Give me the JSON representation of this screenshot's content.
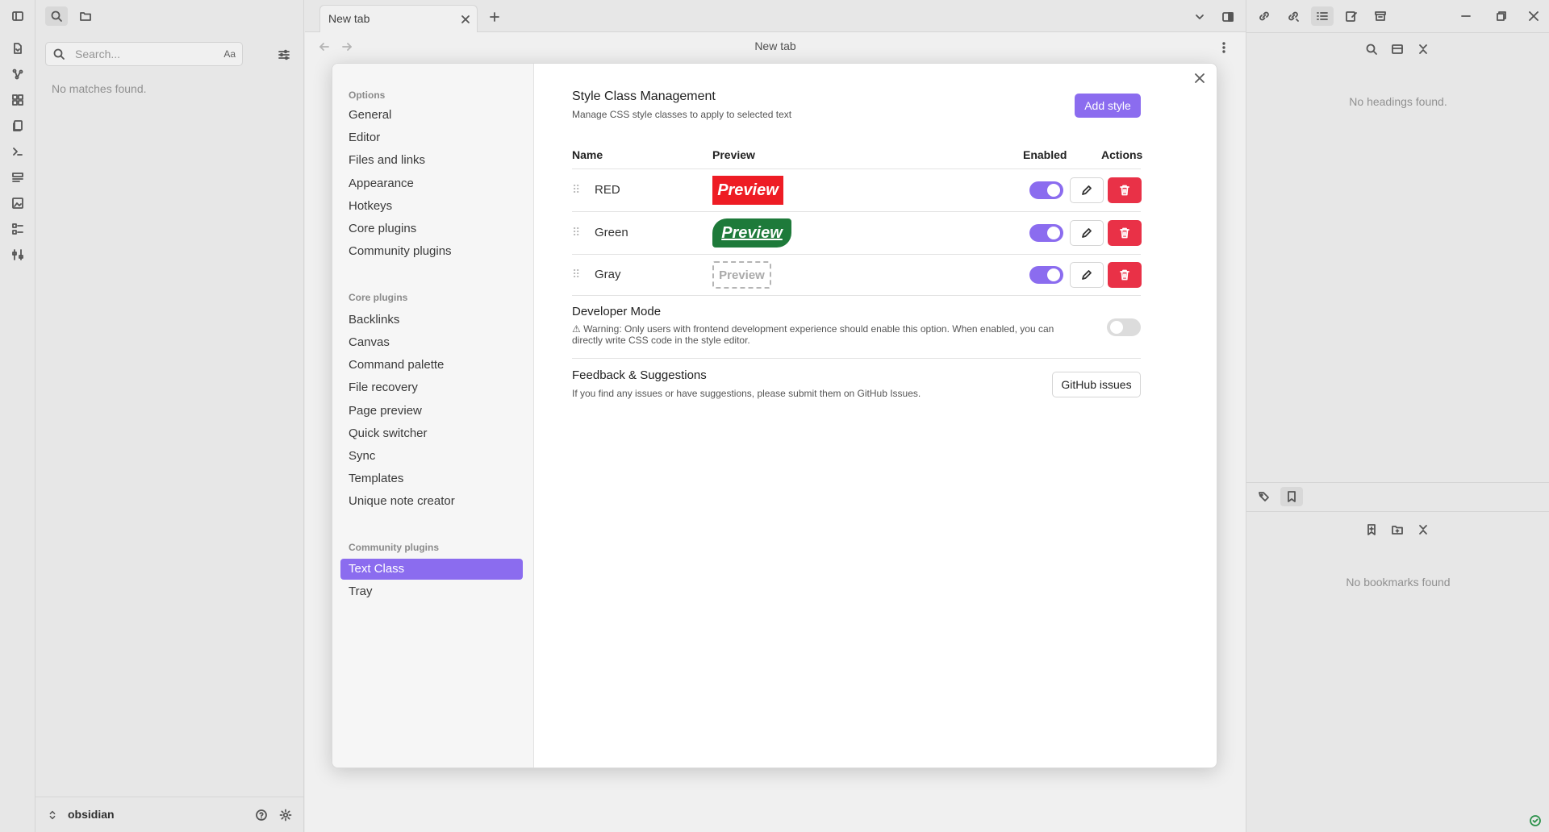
{
  "left_sidebar": {
    "search_placeholder": "Search...",
    "match_case_label": "Aa",
    "empty_text": "No matches found.",
    "vault_name": "obsidian"
  },
  "tabs": [
    {
      "title": "New tab"
    }
  ],
  "view_header": {
    "title": "New tab"
  },
  "settings": {
    "sections": {
      "options": "Options",
      "core_plugins": "Core plugins",
      "community_plugins": "Community plugins"
    },
    "options_items": [
      "General",
      "Editor",
      "Files and links",
      "Appearance",
      "Hotkeys",
      "Core plugins",
      "Community plugins"
    ],
    "core_items": [
      "Backlinks",
      "Canvas",
      "Command palette",
      "File recovery",
      "Page preview",
      "Quick switcher",
      "Sync",
      "Templates",
      "Unique note creator"
    ],
    "community_items": [
      "Text Class",
      "Tray"
    ],
    "active_item": "Text Class"
  },
  "style_mgmt": {
    "title": "Style Class Management",
    "description": "Manage CSS style classes to apply to selected text",
    "add_button": "Add style",
    "columns": {
      "name": "Name",
      "preview": "Preview",
      "enabled": "Enabled",
      "actions": "Actions"
    },
    "rows": [
      {
        "name": "RED",
        "preview": "Preview",
        "enabled": true
      },
      {
        "name": "Green",
        "preview": "Preview",
        "enabled": true
      },
      {
        "name": "Gray",
        "preview": "Preview",
        "enabled": true
      }
    ]
  },
  "developer_mode": {
    "title": "Developer Mode",
    "warning_line1": "⚠ Warning: Only users with frontend development experience should enable this option. When enabled, you can",
    "warning_line2": "directly write CSS code in the style editor.",
    "enabled": false
  },
  "feedback": {
    "title": "Feedback & Suggestions",
    "description": "If you find any issues or have suggestions, please submit them on GitHub Issues.",
    "button": "GitHub issues"
  },
  "right_sidebar": {
    "outline_empty": "No headings found.",
    "bookmarks_empty": "No bookmarks found"
  },
  "colors": {
    "accent": "#8b6cef",
    "danger": "#e93147",
    "preview_red": "#ee1c24",
    "preview_green": "#1e7a3a"
  }
}
